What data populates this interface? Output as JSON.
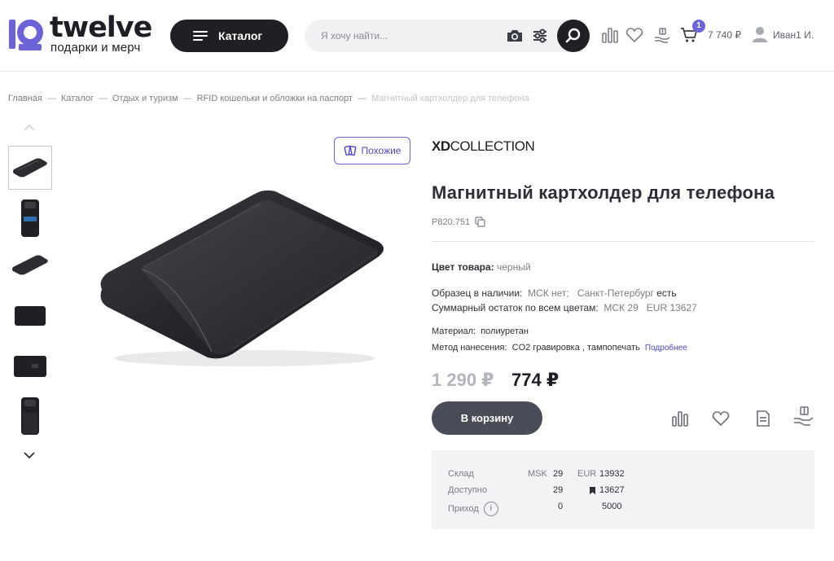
{
  "header": {
    "logo_word": "twelve",
    "logo_sub": "подарки и мерч",
    "catalog_label": "Каталог",
    "search_placeholder": "Я хочу найти...",
    "cart_count": "1",
    "cart_sum": "7 740 ₽",
    "user_name": "Иван1 И."
  },
  "breadcrumb": {
    "items": [
      "Главная",
      "Каталог",
      "Отдых и туризм",
      "RFID кошельки и обложки на паспорт"
    ],
    "current": "Магнитный картхолдер для телефона"
  },
  "product": {
    "similar_label": "Похожие",
    "brand_bold": "XD",
    "brand_rest": "COLLECTION",
    "title": "Магнитный картхолдер для телефона",
    "sku": "P820.751",
    "color_label": "Цвет товара:",
    "color_value": "черный",
    "sample_label": "Образец в наличии:",
    "sample_msk": "МСК нет;",
    "sample_spb_label": "Санкт-Петербург",
    "sample_spb_value": "есть",
    "total_label": "Суммарный остаток по всем цветам:",
    "total_msk": "МСК 29",
    "total_eur": "EUR 13627",
    "material_label": "Материал:",
    "material_value": "полиуретан",
    "method_label": "Метод нанесения:",
    "method_value": "CO2 гравировка , тампопечать",
    "method_link": "Подробнее",
    "old_price": "1 290 ₽",
    "new_price": "774 ₽",
    "cart_button": "В корзину"
  },
  "stock": {
    "row1": {
      "label": "Склад",
      "msk_label": "MSK",
      "msk": "29",
      "eur_label": "EUR",
      "eur": "13932"
    },
    "row2": {
      "label": "Доступно",
      "msk": "29",
      "eur": "13627"
    },
    "row3": {
      "label": "Приход",
      "info": "i",
      "msk": "0",
      "eur": "5000"
    }
  },
  "colors": {
    "accent": "#6c63d8",
    "dark": "#1f2024",
    "button": "#4a4d57"
  }
}
